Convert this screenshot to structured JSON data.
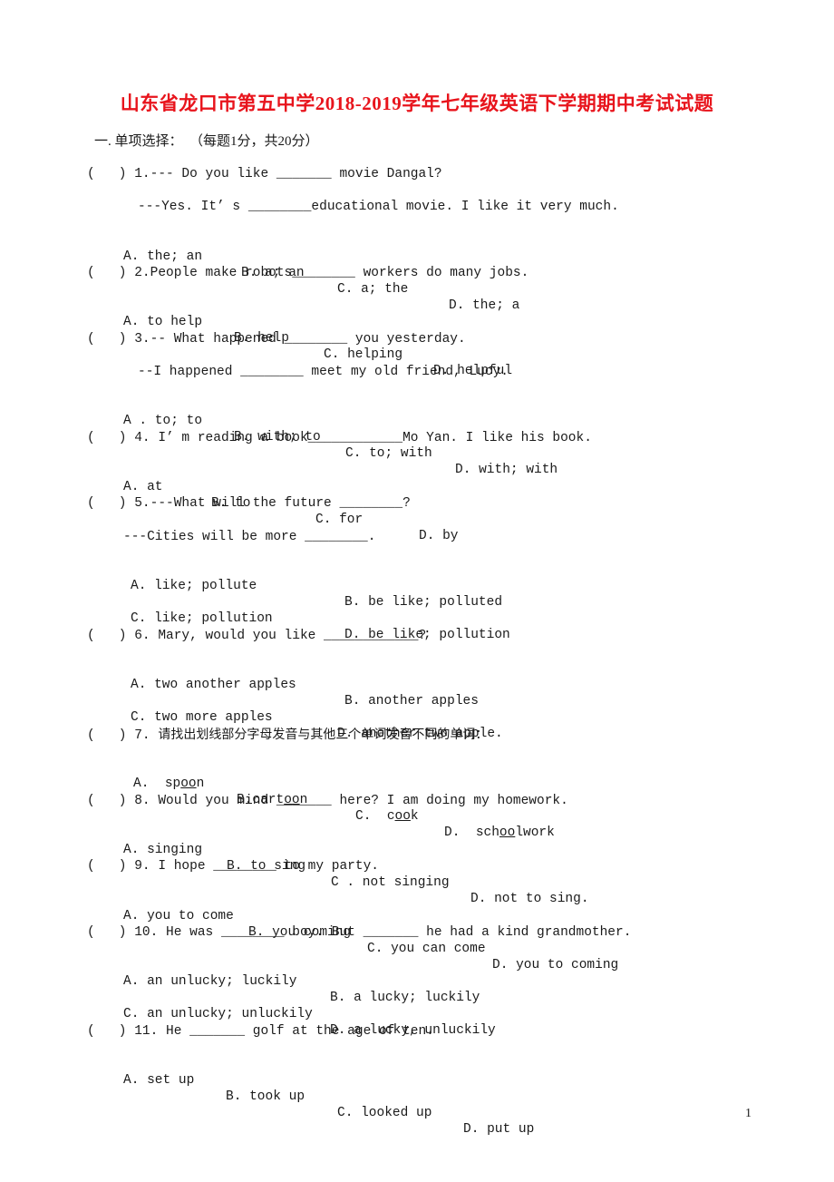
{
  "title": "山东省龙口市第五中学2018-2019学年七年级英语下学期期中考试试题",
  "section": {
    "label": "一. 单项选择：",
    "scoring": "（每题1分，共20分）"
  },
  "questions": [
    {
      "num": "1.",
      "lines": [
        "--- Do you like _______ movie Dangal?",
        "---Yes. It’ s ________educational movie. I like it very much."
      ],
      "options": [
        "A. the; an",
        "B. a; an",
        "C. a; the",
        "D. the; a"
      ]
    },
    {
      "num": "2.",
      "lines": [
        "People make robots________ workers do many jobs."
      ],
      "options": [
        "A. to help",
        "B. help",
        "C. helping",
        "D. helpful"
      ]
    },
    {
      "num": "3.",
      "lines": [
        "-- What happened ________ you yesterday.",
        "--I happened ________ meet my old friend, Lucy."
      ],
      "options": [
        "A . to; to",
        "B. with; to",
        "C. to; with",
        "D. with; with"
      ]
    },
    {
      "num": "4.",
      "lines": [
        "I’ m reading a book____________Mo Yan. I like his book."
      ],
      "options": [
        "A. at",
        "B. to",
        "C. for",
        "D. by"
      ]
    },
    {
      "num": "5.",
      "lines": [
        "---What will the future ________?",
        "---Cities will be more ________."
      ],
      "options": [
        "A. like; pollute",
        "B. be like; polluted",
        "C. like; pollution",
        "D. be like; pollution"
      ]
    },
    {
      "num": "6.",
      "lines": [
        "Mary, would you like ____________?"
      ],
      "options": [
        "A. two another apples",
        "B. another apples",
        "C. two more apples",
        "D. another two apple."
      ]
    },
    {
      "num": "7.",
      "lines": [
        "请找出划线部分字母发音与其他三个单词发音不同的单词："
      ],
      "options": [
        {
          "label": "A.",
          "pre": "sp",
          "under": "oo",
          "post": "n"
        },
        {
          "label": "B.",
          "pre": "cart",
          "under": "oo",
          "post": "n"
        },
        {
          "label": "C.",
          "pre": "c",
          "under": "oo",
          "post": "k"
        },
        {
          "label": "D.",
          "pre": "sch",
          "under": "oo",
          "post": "lwork"
        }
      ]
    },
    {
      "num": "8.",
      "lines": [
        "Would you mind _______ here? I am doing my homework."
      ],
      "options": [
        "A. singing",
        "B. to sing",
        "C . not singing",
        "D. not to sing."
      ]
    },
    {
      "num": "9.",
      "lines": [
        "I hope ________ to my party."
      ],
      "options": [
        "A. you to come",
        "B. you coming",
        "C. you can come",
        "D. you to coming"
      ]
    },
    {
      "num": "10.",
      "lines": [
        "He was ________ boy. But _______ he had a kind grandmother."
      ],
      "options": [
        "A. an unlucky; luckily",
        "B. a lucky; luckily",
        "C. an unlucky; unluckily",
        "D. a lucky, unluckily"
      ]
    },
    {
      "num": "11.",
      "lines": [
        "He _______ golf at the age of ten."
      ],
      "options": [
        "A. set up",
        "B. took up",
        "C. looked up",
        "D. put up"
      ]
    }
  ],
  "answer_bracket": "(   )",
  "page_number": "1",
  "colors": {
    "title": "#e8141c",
    "text": "#1a1a1a"
  }
}
